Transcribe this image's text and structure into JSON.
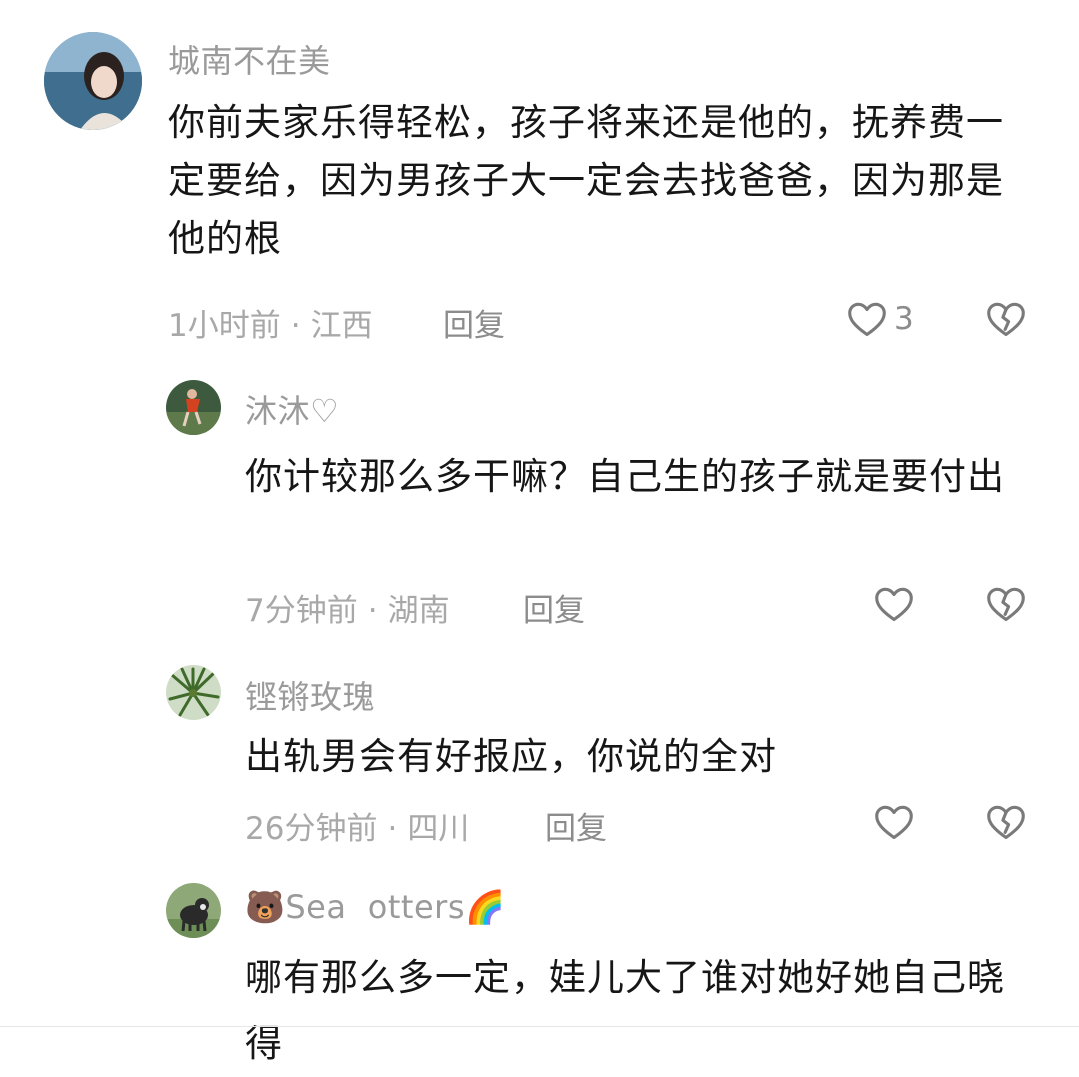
{
  "comments": [
    {
      "username": "城南不在美",
      "content": "你前夫家乐得轻松，孩子将来还是他的，抚养费一定要给，因为男孩子大一定会去找爸爸，因为那是他的根",
      "time": "1小时前",
      "location": "江西",
      "reply_label": "回复",
      "likes": "3"
    },
    {
      "username": "沐沐♡",
      "content": "你计较那么多干嘛？自己生的孩子就是要付出",
      "time": "7分钟前",
      "location": "湖南",
      "reply_label": "回复"
    },
    {
      "username": "铿锵玫瑰",
      "content": "出轨男会有好报应，你说的全对",
      "time": "26分钟前",
      "location": "四川",
      "reply_label": "回复"
    },
    {
      "username_emoji": "🐻",
      "username": "Sea  otters",
      "username_suffix": "🌈",
      "content": "哪有那么多一定，娃儿大了谁对她好她自己晓得"
    }
  ],
  "separator": "·",
  "icons": {
    "like": "heart-outline-icon",
    "dislike": "broken-heart-icon"
  },
  "colors": {
    "text": "#161616",
    "username": "#9a9a9a",
    "meta": "#a8a8a8",
    "icon": "#7a7a7a"
  }
}
